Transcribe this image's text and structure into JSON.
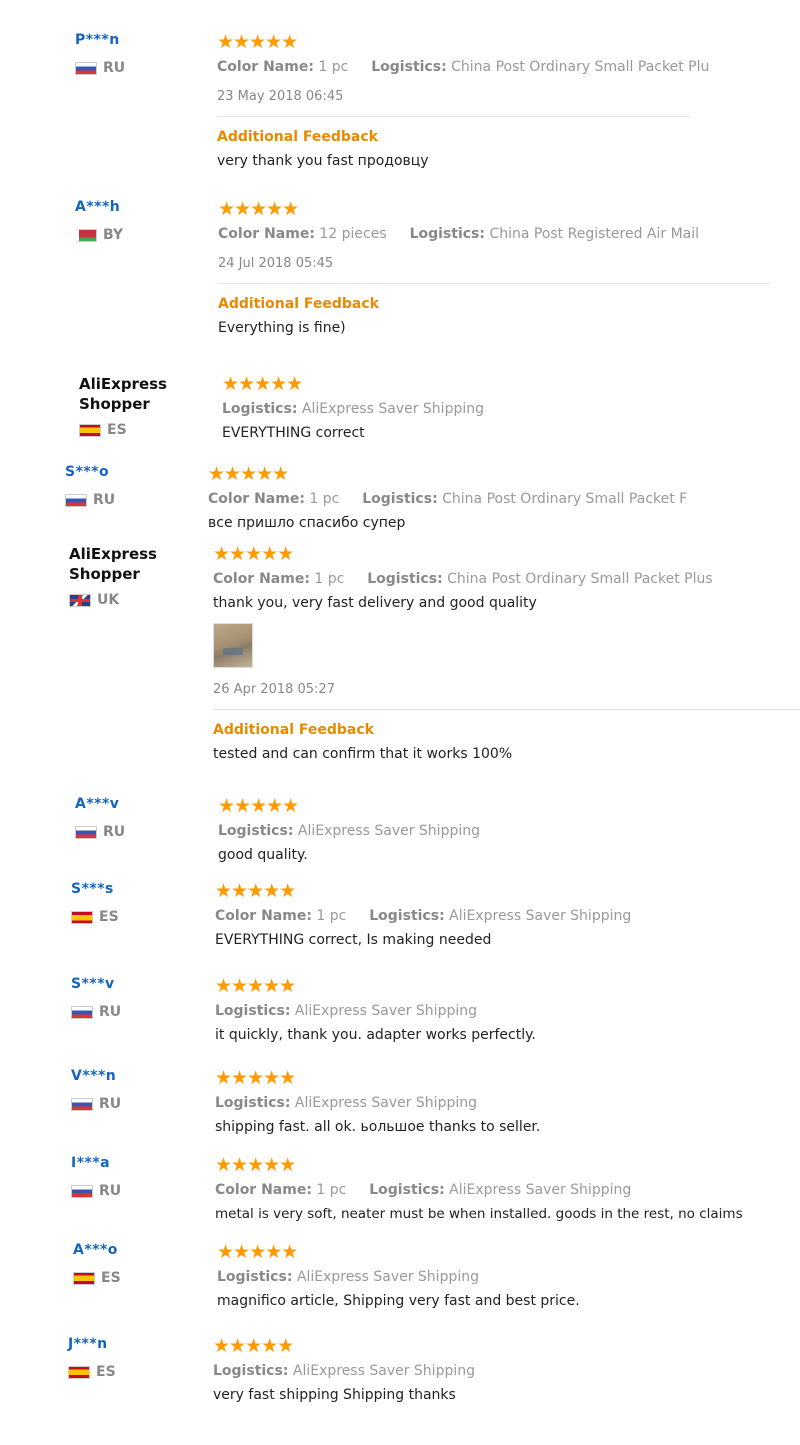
{
  "stars": "★★★★★",
  "reviews": [
    {
      "user": "P***n",
      "country": "RU",
      "flag": "ru",
      "color_label": "Color Name:",
      "color_value": "1 pc",
      "logistics_label": "Logistics:",
      "logistics_value": "China Post Ordinary Small Packet Plu",
      "date": "23 May 2018 06:45",
      "additional_label": "Additional Feedback",
      "additional_text": "very thank you fast продовцу"
    },
    {
      "user": "A***h",
      "country": "BY",
      "flag": "by",
      "color_label": "Color Name:",
      "color_value": "12 pieces",
      "logistics_label": "Logistics:",
      "logistics_value": "China Post Registered Air Mail",
      "date": "24 Jul 2018 05:45",
      "additional_label": "Additional Feedback",
      "additional_text": "Everything is fine)"
    },
    {
      "user": "AliExpress Shopper",
      "country": "ES",
      "flag": "es",
      "logistics_label": "Logistics:",
      "logistics_value": "AliExpress Saver Shipping",
      "text": "EVERYTHING correct"
    },
    {
      "user": "S***o",
      "country": "RU",
      "flag": "ru",
      "color_label": "Color Name:",
      "color_value": "1 pc",
      "logistics_label": "Logistics:",
      "logistics_value": "China Post Ordinary Small Packet F",
      "text": "все пришло спасибо супер"
    },
    {
      "user": "AliExpress Shopper",
      "country": "UK",
      "flag": "uk",
      "color_label": "Color Name:",
      "color_value": "1 pc",
      "logistics_label": "Logistics:",
      "logistics_value": "China Post Ordinary Small Packet Plus",
      "text": "thank you, very fast delivery and good quality",
      "date": "26 Apr 2018 05:27",
      "additional_label": "Additional Feedback",
      "additional_text": "tested and can confirm that it works 100%"
    },
    {
      "user": "A***v",
      "country": "RU",
      "flag": "ru",
      "logistics_label": "Logistics:",
      "logistics_value": "AliExpress Saver Shipping",
      "text": "good quality."
    },
    {
      "user": "S***s",
      "country": "ES",
      "flag": "es",
      "color_label": "Color Name:",
      "color_value": "1 pc",
      "logistics_label": "Logistics:",
      "logistics_value": "AliExpress Saver Shipping",
      "text": "EVERYTHING correct, Is making needed"
    },
    {
      "user": "S***v",
      "country": "RU",
      "flag": "ru",
      "logistics_label": "Logistics:",
      "logistics_value": "AliExpress Saver Shipping",
      "text": "it quickly, thank you. adapter works perfectly."
    },
    {
      "user": "V***n",
      "country": "RU",
      "flag": "ru",
      "logistics_label": "Logistics:",
      "logistics_value": "AliExpress Saver Shipping",
      "text": "shipping fast. all ok. ьольшое thanks to seller."
    },
    {
      "user": "I***a",
      "country": "RU",
      "flag": "ru",
      "color_label": "Color Name:",
      "color_value": "1 pc",
      "logistics_label": "Logistics:",
      "logistics_value": "AliExpress Saver Shipping",
      "text": "metal is very soft, neater must be when installed. goods in the rest, no claims"
    },
    {
      "user": "A***o",
      "country": "ES",
      "flag": "es",
      "logistics_label": "Logistics:",
      "logistics_value": "AliExpress Saver Shipping",
      "text": "magnifico article, Shipping very fast and best price."
    },
    {
      "user": "J***n",
      "country": "ES",
      "flag": "es",
      "logistics_label": "Logistics:",
      "logistics_value": "AliExpress Saver Shipping",
      "text": "very fast shipping Shipping thanks"
    }
  ]
}
